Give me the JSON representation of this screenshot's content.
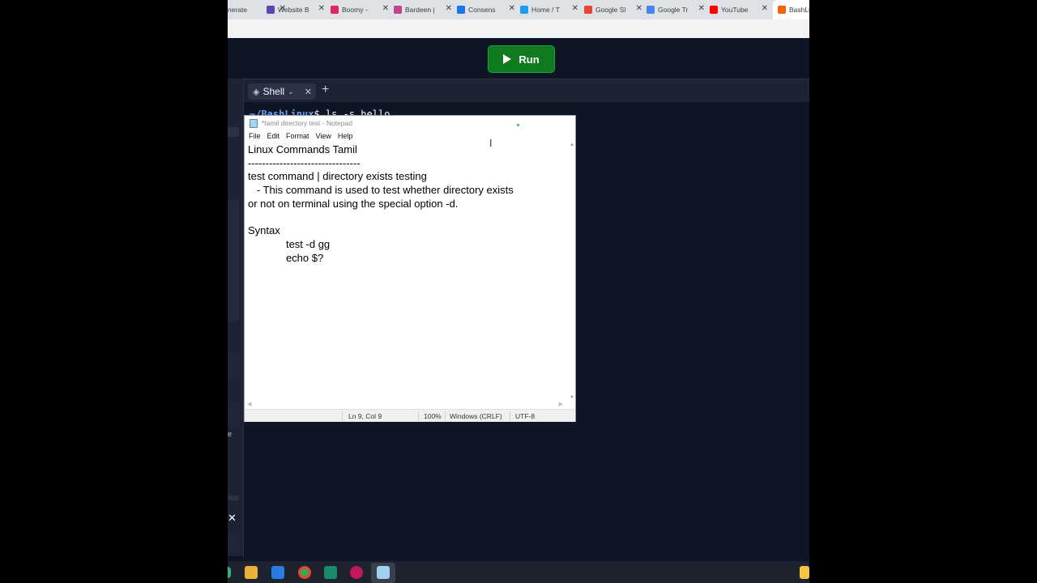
{
  "browser": {
    "tabs": [
      {
        "label": "nerate",
        "icon": "generic-tab-icon",
        "color": "#9aa0a6"
      },
      {
        "label": "Website B",
        "icon": "website-favicon",
        "color": "#5f43b2"
      },
      {
        "label": "Boomy - ",
        "icon": "boomy-favicon",
        "color": "#e0245e"
      },
      {
        "label": "Bardeen |",
        "icon": "bardeen-favicon",
        "color": "#c5428a"
      },
      {
        "label": "Consens",
        "icon": "consensus-favicon",
        "color": "#1a73e8"
      },
      {
        "label": "Home / T",
        "icon": "twitter-icon",
        "color": "#1d9bf0"
      },
      {
        "label": "Google Sl",
        "icon": "google-icon",
        "color": "#ea4335"
      },
      {
        "label": "Google Tr",
        "icon": "google-translate-icon",
        "color": "#4285f4"
      },
      {
        "label": "YouTube",
        "icon": "youtube-icon",
        "color": "#ff0000"
      },
      {
        "label": "BashLin",
        "icon": "replit-icon",
        "color": "#f26207"
      }
    ]
  },
  "replit": {
    "run_label": "Run",
    "shell_tab_label": "Shell",
    "terminal": {
      "path": "~/BashLinux",
      "prompt": "$",
      "command": " ls -s hello"
    }
  },
  "notepad": {
    "title": "*tamil directory test - Notepad",
    "menu": [
      "File",
      "Edit",
      "Format",
      "View",
      "Help"
    ],
    "content": "Linux Commands Tamil\n--------------------------------\ntest command | directory exists testing\n   - This command is used to test whether directory exists\nor not on terminal using the special option -d.\n\nSyntax\n             test -d gg\n             echo $?",
    "status": {
      "position": "Ln 9, Col 9",
      "zoom": "100%",
      "line_ending": "Windows (CRLF)",
      "encoding": "UTF-8"
    }
  },
  "side": {
    "close_glyph": "✕",
    "edge_letter": "e"
  }
}
